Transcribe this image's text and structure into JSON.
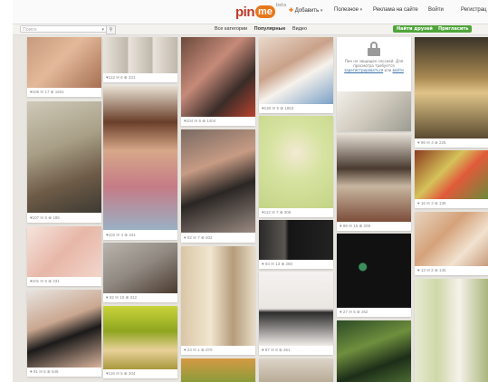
{
  "header": {
    "logo_main": "pin",
    "logo_accent": "me",
    "logo_badge": "beta",
    "nav": {
      "add": "Добавить",
      "popular": "Полезное",
      "ads": "Реклама на сайте",
      "login": "Войти",
      "register": "Регистрац"
    }
  },
  "subbar": {
    "search_placeholder": "Поиск",
    "filters": [
      "Все категории",
      "Популярные",
      "Видео"
    ],
    "find_friends": "Найти друзей",
    "invite": "Пригласить"
  },
  "pins": [
    {
      "id": "c1a",
      "stats": "♥106  ✉ 17  ⊕ 1601"
    },
    {
      "id": "c1b",
      "stats": "♥107  ✉ 5  ⊕ 185"
    },
    {
      "id": "c1c",
      "stats": "♥101  ✉ 5  ⊕ 231"
    },
    {
      "id": "c1d",
      "stats": "♥ 91  ✉ 6  ⊕ 546"
    },
    {
      "id": "c2a",
      "stats": "♥112  ✉ 6  ⊕ 231"
    },
    {
      "id": "c2b",
      "stats": "♥102  ✉ 4  ⊕ 341"
    },
    {
      "id": "c2c",
      "stats": "♥ 92  ✉ 10  ⊕ 312"
    },
    {
      "id": "c2d",
      "stats": "♥116  ✉ 5  ⊕ 204"
    },
    {
      "id": "c3a",
      "stats": "♥104  ✉ 6  ⊕ 1404"
    },
    {
      "id": "c3b",
      "stats": "♥ 92  ✉ 7  ⊕ 402"
    },
    {
      "id": "c3c",
      "stats": "♥ 24  ✉ 1  ⊕ 370"
    },
    {
      "id": "c4a",
      "stats": "♥130  ✉ 5  ⊕ 1863"
    },
    {
      "id": "c4b",
      "stats": "♥112  ✉ 7  ⊕ 306"
    },
    {
      "id": "c4c",
      "stats": "♥ 84  ✉ 13  ⊕ 260"
    },
    {
      "id": "c4d",
      "stats": "♥ 87  ✉ 8  ⊕ 361"
    },
    {
      "id": "c5b",
      "stats": "♥ 98  ✉ 16  ⊕ 208"
    },
    {
      "id": "c5c",
      "stats": "♥ 27  ✉ 6  ⊕ 262"
    },
    {
      "id": "c6a",
      "stats": "♥ 96  ✉ 4  ⊕ 225"
    },
    {
      "id": "c6b",
      "stats": "♥ 16  ✉ 3  ⊕ 135"
    },
    {
      "id": "c6c",
      "stats": "♥ 13  ✉ 2  ⊕ 146"
    }
  ],
  "locked_pin": {
    "text": "Пин не защищен сессией. Для просмотра требуется",
    "link": "зарегистрироваться",
    "or": "или",
    "link2": "войти"
  }
}
